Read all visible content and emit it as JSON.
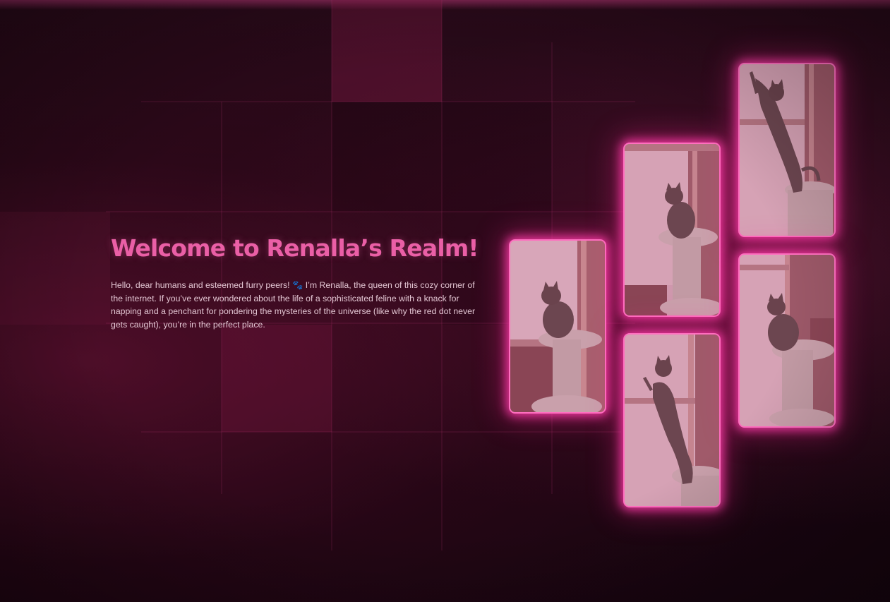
{
  "hero": {
    "title": "Welcome to Renalla’s Realm!",
    "body": "Hello, dear humans and esteemed furry peers! 🐾 I’m Renalla, the queen of this cozy corner of the internet. If you’ve ever wondered about the life of a sophisticated feline with a knack for napping and a penchant for pondering the mysteries of the universe (like why the red dot never gets caught), you’re in the perfect place."
  },
  "gallery": {
    "accent_color": "#ff6fc0",
    "photos": [
      {
        "subject": "cat sitting on cat tree by window"
      },
      {
        "subject": "cat sitting on cat tree looking out window"
      },
      {
        "subject": "cat standing up on cat tree reaching window"
      },
      {
        "subject": "cat stretching up against window"
      },
      {
        "subject": "cat sitting on cat tree perch by window"
      }
    ]
  },
  "colors": {
    "background": "#1d0612",
    "title": "#ea5fa6",
    "body_text": "#e3c6d3",
    "glow": "#ff6fc0"
  }
}
